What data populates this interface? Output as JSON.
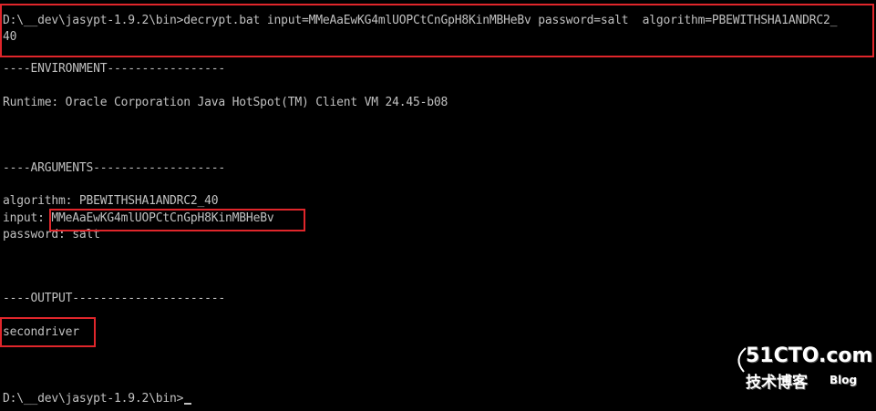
{
  "console": {
    "command_line_1": "D:\\__dev\\jasypt-1.9.2\\bin>decrypt.bat input=MMeAaEwKG4mlUOPCtCnGpH8KinMBHeBv password=salt  algorithm=PBEWITHSHA1ANDRC2_",
    "command_line_2": "40",
    "env_header": "----ENVIRONMENT-----------------",
    "runtime": "Runtime: Oracle Corporation Java HotSpot(TM) Client VM 24.45-b08",
    "args_header": "----ARGUMENTS-------------------",
    "algorithm": "algorithm: PBEWITHSHA1ANDRC2_40",
    "input_label": "input: ",
    "input_value": "MMeAaEwKG4mlUOPCtCnGpH8KinMBHeBv",
    "password": "password: salt",
    "output_header": "----OUTPUT----------------------",
    "output_value": "secondriver",
    "prompt": "D:\\__dev\\jasypt-1.9.2\\bin>"
  },
  "watermark": {
    "brand": "51CTO.com",
    "subtitle": "技术博客",
    "blog": "Blog"
  },
  "colors": {
    "background": "#000000",
    "text": "#c0c0c0",
    "highlight_box": "#e0262b"
  }
}
